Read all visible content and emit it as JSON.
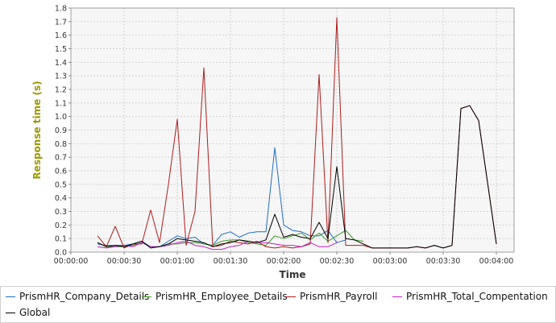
{
  "chart_data": {
    "type": "line",
    "title": "",
    "xlabel": "Time",
    "ylabel": "Response time (s)",
    "xlim": [
      "00:00:00",
      "00:04:10"
    ],
    "ylim": [
      0.0,
      1.8
    ],
    "x_ticks": [
      "00:00:00",
      "00:00:30",
      "00:01:00",
      "00:01:30",
      "00:02:00",
      "00:02:30",
      "00:03:00",
      "00:03:30",
      "00:04:00"
    ],
    "y_ticks": [
      "0.0",
      "0.1",
      "0.2",
      "0.3",
      "0.4",
      "0.5",
      "0.6",
      "0.7",
      "0.8",
      "0.9",
      "1.0",
      "1.1",
      "1.2",
      "1.3",
      "1.4",
      "1.5",
      "1.6",
      "1.7",
      "1.8"
    ],
    "grid": true,
    "legend_position": "bottom",
    "series": [
      {
        "name": "PrismHR_Company_Details",
        "color": "#1f6fc5",
        "points": [
          [
            "00:00:15",
            0.06
          ],
          [
            "00:00:20",
            0.05
          ],
          [
            "00:00:25",
            0.05
          ],
          [
            "00:00:30",
            0.05
          ],
          [
            "00:00:35",
            0.06
          ],
          [
            "00:00:40",
            0.08
          ],
          [
            "00:00:45",
            0.04
          ],
          [
            "00:00:50",
            0.04
          ],
          [
            "00:00:55",
            0.08
          ],
          [
            "00:01:00",
            0.12
          ],
          [
            "00:01:05",
            0.1
          ],
          [
            "00:01:10",
            0.11
          ],
          [
            "00:01:15",
            0.06
          ],
          [
            "00:01:20",
            0.05
          ],
          [
            "00:01:25",
            0.13
          ],
          [
            "00:01:30",
            0.15
          ],
          [
            "00:01:35",
            0.11
          ],
          [
            "00:01:40",
            0.14
          ],
          [
            "00:01:45",
            0.15
          ],
          [
            "00:01:50",
            0.15
          ],
          [
            "00:01:55",
            0.77
          ],
          [
            "00:02:00",
            0.2
          ],
          [
            "00:02:05",
            0.16
          ],
          [
            "00:02:10",
            0.15
          ],
          [
            "00:02:15",
            0.12
          ],
          [
            "00:02:20",
            0.12
          ],
          [
            "00:02:25",
            0.16
          ],
          [
            "00:02:30",
            0.07
          ],
          [
            "00:02:35",
            0.09
          ]
        ]
      },
      {
        "name": "PrismHR_Employee_Details",
        "color": "#3c9e2a",
        "points": [
          [
            "00:00:15",
            0.07
          ],
          [
            "00:00:20",
            0.04
          ],
          [
            "00:00:25",
            0.04
          ],
          [
            "00:00:30",
            0.04
          ],
          [
            "00:00:35",
            0.05
          ],
          [
            "00:00:40",
            0.07
          ],
          [
            "00:00:45",
            0.04
          ],
          [
            "00:00:50",
            0.04
          ],
          [
            "00:00:55",
            0.06
          ],
          [
            "00:01:00",
            0.06
          ],
          [
            "00:01:05",
            0.07
          ],
          [
            "00:01:10",
            0.07
          ],
          [
            "00:01:15",
            0.06
          ],
          [
            "00:01:20",
            0.05
          ],
          [
            "00:01:25",
            0.08
          ],
          [
            "00:01:30",
            0.09
          ],
          [
            "00:01:35",
            0.09
          ],
          [
            "00:01:40",
            0.07
          ],
          [
            "00:01:45",
            0.06
          ],
          [
            "00:01:50",
            0.05
          ],
          [
            "00:01:55",
            0.12
          ],
          [
            "00:02:00",
            0.1
          ],
          [
            "00:02:05",
            0.12
          ],
          [
            "00:02:10",
            0.14
          ],
          [
            "00:02:15",
            0.09
          ],
          [
            "00:02:20",
            0.14
          ],
          [
            "00:02:25",
            0.08
          ],
          [
            "00:02:30",
            0.12
          ],
          [
            "00:02:35",
            0.16
          ],
          [
            "00:02:40",
            0.09
          ],
          [
            "00:02:45",
            0.08
          ]
        ]
      },
      {
        "name": "PrismHR_Payroll",
        "color": "#b01c1c",
        "points": [
          [
            "00:00:15",
            0.12
          ],
          [
            "00:00:20",
            0.04
          ],
          [
            "00:00:25",
            0.19
          ],
          [
            "00:00:30",
            0.03
          ],
          [
            "00:00:35",
            0.06
          ],
          [
            "00:00:40",
            0.06
          ],
          [
            "00:00:45",
            0.31
          ],
          [
            "00:00:50",
            0.07
          ],
          [
            "00:00:55",
            0.5
          ],
          [
            "00:01:00",
            0.98
          ],
          [
            "00:01:05",
            0.05
          ],
          [
            "00:01:10",
            0.3
          ],
          [
            "00:01:15",
            1.36
          ],
          [
            "00:01:20",
            0.04
          ],
          [
            "00:01:25",
            0.05
          ],
          [
            "00:01:30",
            0.08
          ],
          [
            "00:01:35",
            0.07
          ],
          [
            "00:01:40",
            0.06
          ],
          [
            "00:01:45",
            0.08
          ],
          [
            "00:01:50",
            0.04
          ],
          [
            "00:01:55",
            0.03
          ],
          [
            "00:02:00",
            0.04
          ],
          [
            "00:02:05",
            0.03
          ],
          [
            "00:02:10",
            0.04
          ],
          [
            "00:02:15",
            0.06
          ],
          [
            "00:02:20",
            1.31
          ],
          [
            "00:02:25",
            0.07
          ],
          [
            "00:02:30",
            1.73
          ],
          [
            "00:02:35",
            0.05
          ],
          [
            "00:02:40",
            0.05
          ],
          [
            "00:02:45",
            0.05
          ],
          [
            "00:02:50",
            0.03
          ],
          [
            "00:02:55",
            0.03
          ],
          [
            "00:03:00",
            0.03
          ],
          [
            "00:03:05",
            0.03
          ],
          [
            "00:03:10",
            0.03
          ],
          [
            "00:03:15",
            0.04
          ],
          [
            "00:03:20",
            0.03
          ],
          [
            "00:03:25",
            0.05
          ],
          [
            "00:03:30",
            0.03
          ],
          [
            "00:03:35",
            0.05
          ],
          [
            "00:03:40",
            1.06
          ],
          [
            "00:03:45",
            1.08
          ],
          [
            "00:03:50",
            0.97
          ],
          [
            "00:04:00",
            0.06
          ]
        ]
      },
      {
        "name": "PrismHR_Total_Compentation",
        "color": "#c020c0",
        "points": [
          [
            "00:00:15",
            0.04
          ],
          [
            "00:00:20",
            0.03
          ],
          [
            "00:00:25",
            0.04
          ],
          [
            "00:00:30",
            0.05
          ],
          [
            "00:00:35",
            0.04
          ],
          [
            "00:00:40",
            0.07
          ],
          [
            "00:00:45",
            0.04
          ],
          [
            "00:00:50",
            0.04
          ],
          [
            "00:00:55",
            0.05
          ],
          [
            "00:01:00",
            0.07
          ],
          [
            "00:01:05",
            0.08
          ],
          [
            "00:01:10",
            0.05
          ],
          [
            "00:01:15",
            0.04
          ],
          [
            "00:01:20",
            0.02
          ],
          [
            "00:01:25",
            0.02
          ],
          [
            "00:01:30",
            0.04
          ],
          [
            "00:01:35",
            0.05
          ],
          [
            "00:01:40",
            0.08
          ],
          [
            "00:01:45",
            0.07
          ],
          [
            "00:01:50",
            0.07
          ],
          [
            "00:01:55",
            0.06
          ],
          [
            "00:02:00",
            0.05
          ],
          [
            "00:02:05",
            0.05
          ],
          [
            "00:02:10",
            0.04
          ],
          [
            "00:02:15",
            0.07
          ],
          [
            "00:02:20",
            0.04
          ],
          [
            "00:02:25",
            0.04
          ],
          [
            "00:02:30",
            0.07
          ]
        ]
      },
      {
        "name": "Global",
        "color": "#000000",
        "points": [
          [
            "00:00:15",
            0.07
          ],
          [
            "00:00:20",
            0.04
          ],
          [
            "00:00:25",
            0.05
          ],
          [
            "00:00:30",
            0.04
          ],
          [
            "00:00:35",
            0.06
          ],
          [
            "00:00:40",
            0.08
          ],
          [
            "00:00:45",
            0.03
          ],
          [
            "00:00:50",
            0.04
          ],
          [
            "00:00:55",
            0.06
          ],
          [
            "00:01:00",
            0.1
          ],
          [
            "00:01:05",
            0.09
          ],
          [
            "00:01:10",
            0.08
          ],
          [
            "00:01:15",
            0.07
          ],
          [
            "00:01:20",
            0.04
          ],
          [
            "00:01:25",
            0.06
          ],
          [
            "00:01:30",
            0.07
          ],
          [
            "00:01:35",
            0.09
          ],
          [
            "00:01:40",
            0.08
          ],
          [
            "00:01:45",
            0.07
          ],
          [
            "00:01:50",
            0.09
          ],
          [
            "00:01:55",
            0.28
          ],
          [
            "00:02:00",
            0.11
          ],
          [
            "00:02:05",
            0.13
          ],
          [
            "00:02:10",
            0.11
          ],
          [
            "00:02:15",
            0.1
          ],
          [
            "00:02:20",
            0.22
          ],
          [
            "00:02:25",
            0.1
          ],
          [
            "00:02:30",
            0.63
          ],
          [
            "00:02:35",
            0.1
          ],
          [
            "00:02:40",
            0.09
          ],
          [
            "00:02:45",
            0.06
          ],
          [
            "00:02:50",
            0.03
          ],
          [
            "00:02:55",
            0.03
          ],
          [
            "00:03:00",
            0.03
          ],
          [
            "00:03:05",
            0.03
          ],
          [
            "00:03:10",
            0.03
          ],
          [
            "00:03:15",
            0.04
          ],
          [
            "00:03:20",
            0.03
          ],
          [
            "00:03:25",
            0.05
          ],
          [
            "00:03:30",
            0.03
          ],
          [
            "00:03:35",
            0.05
          ],
          [
            "00:03:40",
            1.06
          ],
          [
            "00:03:45",
            1.08
          ],
          [
            "00:03:50",
            0.97
          ],
          [
            "00:04:00",
            0.06
          ]
        ]
      }
    ]
  }
}
